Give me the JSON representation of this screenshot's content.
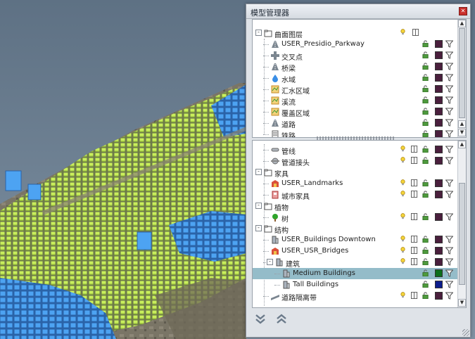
{
  "window": {
    "title": "模型管理器"
  },
  "colors": {
    "accent_row": "#94bcc9",
    "swatch_default": "#4a1f3d",
    "swatch_medium": "#0c6e1a",
    "swatch_tall": "#0c1c8c",
    "buildings_lime": "#c8f05a",
    "buildings_blue": "#3d8fe0"
  },
  "upper_tree": {
    "rows": [
      {
        "label": "曲面图层",
        "icon": "folder-icon",
        "level": 0,
        "toggle": "⊟"
      },
      {
        "label": "USER_Presidio_Parkway",
        "icon": "road-icon",
        "level": 1
      },
      {
        "label": "交叉点",
        "icon": "intersection-icon",
        "level": 1
      },
      {
        "label": "桥梁",
        "icon": "road-icon",
        "level": 1
      },
      {
        "label": "水域",
        "icon": "water-drop-icon",
        "level": 1
      },
      {
        "label": "汇水区域",
        "icon": "map-icon",
        "level": 1
      },
      {
        "label": "溪流",
        "icon": "map-icon",
        "level": 1
      },
      {
        "label": "覆盖区域",
        "icon": "map-icon",
        "level": 1
      },
      {
        "label": "道路",
        "icon": "road-icon",
        "level": 1
      },
      {
        "label": "铁路",
        "icon": "railway-icon",
        "level": 1
      }
    ]
  },
  "lower_tree": {
    "rows": [
      {
        "label": "管线",
        "icon": "pipe-icon",
        "level": 1
      },
      {
        "label": "管道接头",
        "icon": "pipe-joint-icon",
        "level": 1
      },
      {
        "label": "家具",
        "icon": "folder-icon",
        "level": 0,
        "toggle": "⊟"
      },
      {
        "label": "USER_Landmarks",
        "icon": "landmark-icon",
        "level": 1
      },
      {
        "label": "城市家具",
        "icon": "furniture-icon",
        "level": 1
      },
      {
        "label": "植物",
        "icon": "folder-icon",
        "level": 0,
        "toggle": "⊟"
      },
      {
        "label": "树",
        "icon": "tree-icon",
        "level": 1
      },
      {
        "label": "结构",
        "icon": "folder-icon",
        "level": 0,
        "toggle": "⊟"
      },
      {
        "label": "USER_Buildings Downtown",
        "icon": "building-icon",
        "level": 1
      },
      {
        "label": "USER_USR_Bridges",
        "icon": "landmark-icon",
        "level": 1
      },
      {
        "label": "建筑",
        "icon": "building-icon",
        "level": 1,
        "toggle": "⊟"
      },
      {
        "label": "Medium Buildings",
        "icon": "building-icon",
        "level": 2,
        "selected": true
      },
      {
        "label": "Tall Buildings",
        "icon": "building-icon",
        "level": 2
      },
      {
        "label": "道路隔离带",
        "icon": "road-barrier-icon",
        "level": 1
      }
    ]
  }
}
